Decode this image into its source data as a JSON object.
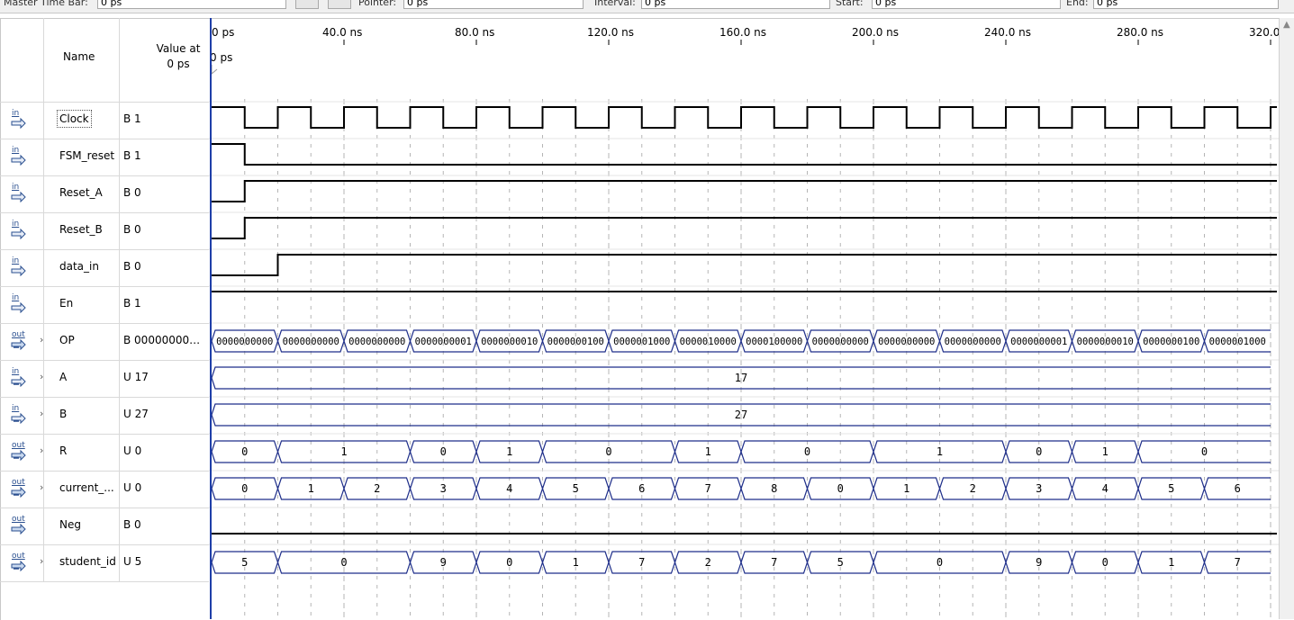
{
  "toolbar": {
    "master_time_bar_label": "Master Time Bar:",
    "master_time_bar_value": "0 ps",
    "pointer_label": "Pointer:",
    "pointer_value": "0 ps",
    "interval_label": "Interval:",
    "interval_value": "0 ps",
    "start_label": "Start:",
    "start_value": "0 ps",
    "end_label": "End:",
    "end_value": "0 ps"
  },
  "header": {
    "name_col": "Name",
    "value_col": "Value at 0 ps",
    "cursor_label": "0 ps"
  },
  "time_ticks": [
    "0 ps",
    "40.0 ns",
    "80.0 ns",
    "120.0 ns",
    "160.0 ns",
    "200.0 ns",
    "240.0 ns",
    "280.0 ns",
    "320.0 ns"
  ],
  "signals": [
    {
      "icon": "input-pin-icon",
      "icon_text": "in",
      "expandable": false,
      "name": "Clock",
      "value": "B 1"
    },
    {
      "icon": "input-pin-icon",
      "icon_text": "in",
      "expandable": false,
      "name": "FSM_reset",
      "value": "B 1"
    },
    {
      "icon": "input-pin-icon",
      "icon_text": "in",
      "expandable": false,
      "name": "Reset_A",
      "value": "B 0"
    },
    {
      "icon": "input-pin-icon",
      "icon_text": "in",
      "expandable": false,
      "name": "Reset_B",
      "value": "B 0"
    },
    {
      "icon": "input-pin-icon",
      "icon_text": "in",
      "expandable": false,
      "name": "data_in",
      "value": "B 0"
    },
    {
      "icon": "input-pin-icon",
      "icon_text": "in",
      "expandable": false,
      "name": "En",
      "value": "B 1"
    },
    {
      "icon": "output-bus-icon",
      "icon_text": "out",
      "expandable": true,
      "name": "OP",
      "value": "B 0000000000..."
    },
    {
      "icon": "input-bus-icon",
      "icon_text": "in",
      "expandable": true,
      "name": "A",
      "value": "U 17"
    },
    {
      "icon": "input-bus-icon",
      "icon_text": "in",
      "expandable": true,
      "name": "B",
      "value": "U 27"
    },
    {
      "icon": "output-bus-icon",
      "icon_text": "out",
      "expandable": true,
      "name": "R",
      "value": "U 0"
    },
    {
      "icon": "output-bus-icon",
      "icon_text": "out",
      "expandable": true,
      "name": "current_...",
      "value": "U 0"
    },
    {
      "icon": "output-pin-icon",
      "icon_text": "out",
      "expandable": false,
      "name": "Neg",
      "value": "B 0"
    },
    {
      "icon": "output-bus-icon",
      "icon_text": "out",
      "expandable": true,
      "name": "student_id",
      "value": "U 5"
    }
  ],
  "waves": {
    "clock": {
      "start_level": 1,
      "half_period_ns": 10
    },
    "FSM_reset": {
      "levels": [
        [
          0,
          1
        ],
        [
          10,
          0
        ]
      ]
    },
    "Reset_A": {
      "levels": [
        [
          0,
          0
        ],
        [
          10,
          1
        ]
      ]
    },
    "Reset_B": {
      "levels": [
        [
          0,
          0
        ],
        [
          10,
          1
        ]
      ]
    },
    "data_in": {
      "levels": [
        [
          0,
          0
        ],
        [
          20,
          1
        ]
      ]
    },
    "En": {
      "levels": [
        [
          0,
          1
        ]
      ]
    },
    "Neg": {
      "levels": [
        [
          0,
          0
        ]
      ]
    },
    "OP": {
      "segments": [
        [
          0,
          20,
          "0000000000"
        ],
        [
          20,
          40,
          "0000000000"
        ],
        [
          40,
          60,
          "0000000000"
        ],
        [
          60,
          80,
          "0000000001"
        ],
        [
          80,
          100,
          "0000000010"
        ],
        [
          100,
          120,
          "0000000100"
        ],
        [
          120,
          140,
          "0000001000"
        ],
        [
          140,
          160,
          "0000010000"
        ],
        [
          160,
          180,
          "0000100000"
        ],
        [
          180,
          200,
          "0000000000"
        ],
        [
          200,
          220,
          "0000000000"
        ],
        [
          220,
          240,
          "0000000000"
        ],
        [
          240,
          260,
          "0000000001"
        ],
        [
          260,
          280,
          "0000000010"
        ],
        [
          280,
          300,
          "0000000100"
        ],
        [
          300,
          320,
          "0000001000"
        ]
      ]
    },
    "A": {
      "segments": [
        [
          0,
          320,
          "17"
        ]
      ]
    },
    "B": {
      "segments": [
        [
          0,
          320,
          "27"
        ]
      ]
    },
    "R": {
      "segments": [
        [
          0,
          20,
          "0"
        ],
        [
          20,
          60,
          "1"
        ],
        [
          60,
          80,
          "0"
        ],
        [
          80,
          100,
          "1"
        ],
        [
          100,
          140,
          "0"
        ],
        [
          140,
          160,
          "1"
        ],
        [
          160,
          200,
          "0"
        ],
        [
          200,
          240,
          "1"
        ],
        [
          240,
          260,
          "0"
        ],
        [
          260,
          280,
          "1"
        ],
        [
          280,
          320,
          "0"
        ]
      ]
    },
    "current": {
      "segments": [
        [
          0,
          20,
          "0"
        ],
        [
          20,
          40,
          "1"
        ],
        [
          40,
          60,
          "2"
        ],
        [
          60,
          80,
          "3"
        ],
        [
          80,
          100,
          "4"
        ],
        [
          100,
          120,
          "5"
        ],
        [
          120,
          140,
          "6"
        ],
        [
          140,
          160,
          "7"
        ],
        [
          160,
          180,
          "8"
        ],
        [
          180,
          200,
          "0"
        ],
        [
          200,
          220,
          "1"
        ],
        [
          220,
          240,
          "2"
        ],
        [
          240,
          260,
          "3"
        ],
        [
          260,
          280,
          "4"
        ],
        [
          280,
          300,
          "5"
        ],
        [
          300,
          320,
          "6"
        ]
      ]
    },
    "student_id": {
      "segments": [
        [
          0,
          20,
          "5"
        ],
        [
          20,
          60,
          "0"
        ],
        [
          60,
          80,
          "9"
        ],
        [
          80,
          100,
          "0"
        ],
        [
          100,
          120,
          "1"
        ],
        [
          120,
          140,
          "7"
        ],
        [
          140,
          160,
          "2"
        ],
        [
          160,
          180,
          "7"
        ],
        [
          180,
          200,
          "5"
        ],
        [
          200,
          240,
          "0"
        ],
        [
          240,
          260,
          "9"
        ],
        [
          260,
          280,
          "0"
        ],
        [
          280,
          300,
          "1"
        ],
        [
          300,
          320,
          "7"
        ]
      ]
    }
  },
  "colors": {
    "wave": "#000000",
    "bus": "#1f2f8a",
    "cursor": "#1f3fa8",
    "grid": "#b5b5b5"
  }
}
